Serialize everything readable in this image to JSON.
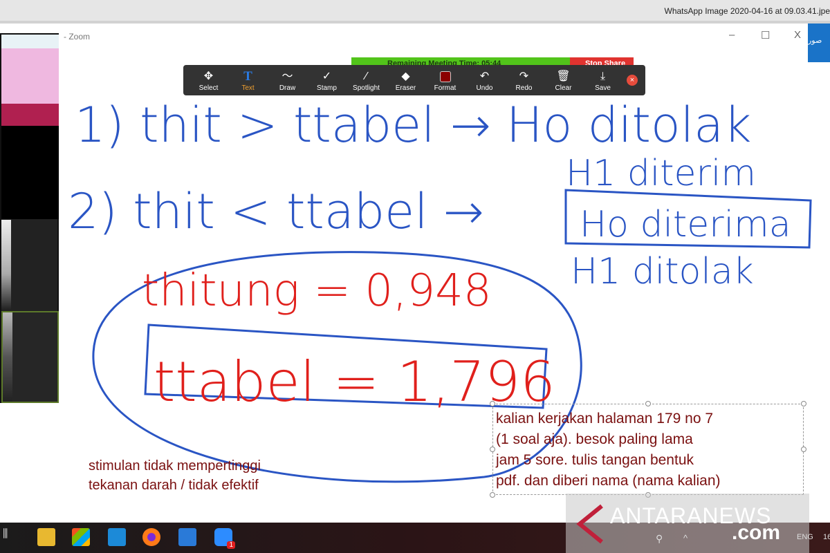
{
  "viewer": {
    "filename": "WhatsApp Image 2020-04-16 at 09.03.41.jpe"
  },
  "window": {
    "title": "- Zoom",
    "minimize": "–",
    "maximize": "☐",
    "close": "X",
    "side_label": "صور"
  },
  "share_bar": {
    "timer": "Remaining Meeting Time: 05:44",
    "stop": "Stop Share"
  },
  "toolbar": {
    "tools": [
      {
        "label": "Select",
        "icon": "✥"
      },
      {
        "label": "Text",
        "icon": "T",
        "active": true
      },
      {
        "label": "Draw",
        "icon": "〜"
      },
      {
        "label": "Stamp",
        "icon": "✓"
      },
      {
        "label": "Spotlight",
        "icon": "⁄"
      },
      {
        "label": "Eraser",
        "icon": "◆"
      },
      {
        "label": "Format",
        "icon": "swatch"
      },
      {
        "label": "Undo",
        "icon": "↶"
      },
      {
        "label": "Redo",
        "icon": "↷"
      },
      {
        "label": "Clear",
        "icon": "🗑"
      },
      {
        "label": "Save",
        "icon": "⤓"
      }
    ],
    "format_color": "#8b0000",
    "close": "×"
  },
  "whiteboard": {
    "line1": "1) thit > ttabel → Ho ditolak",
    "line1b": "H1 diterim",
    "line2a": "2) thit < ttabel →",
    "line2b": "Ho diterima",
    "line2c": "H1 ditolak",
    "red1": "thitung = 0,948",
    "red2": "ttabel = 1,796",
    "ink_blue": "#2a55c4",
    "ink_red": "#e0201c"
  },
  "note": {
    "line1": "stimulan tidak mempertinggi",
    "line2": "tekanan darah / tidak efektif"
  },
  "textbox": {
    "lines": [
      "kalian kerjakan halaman 179 no 7",
      "(1 soal aja). besok paling lama",
      "jam 5 sore. tulis tangan bentuk",
      "pdf. dan diberi nama (nama kalian)"
    ]
  },
  "watermark": {
    "brand": "ANTARANEWS",
    "suffix": ".com"
  },
  "taskbar": {
    "lang": "ENG",
    "time": "16",
    "zoom_badge": "1"
  }
}
